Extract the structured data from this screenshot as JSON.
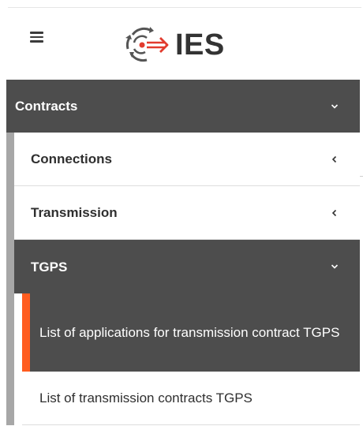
{
  "header": {
    "menu_icon": "hamburger-menu-icon",
    "logo_icon": "ies-logo-arrows-icon",
    "logo_text": "IES"
  },
  "sidebar": {
    "items": [
      {
        "label": "Contracts",
        "icon": "chevron-down-icon",
        "expanded": true,
        "children": [
          {
            "label": "Connections",
            "icon": "chevron-left-icon",
            "expanded": false
          },
          {
            "label": "Transmission",
            "icon": "chevron-left-icon",
            "expanded": false
          },
          {
            "label": "TGPS",
            "icon": "chevron-down-icon",
            "expanded": true,
            "children": [
              {
                "label": "List of applications for transmission contract TGPS",
                "current": true
              },
              {
                "label": "List of transmission contracts TGPS",
                "current": false
              }
            ]
          }
        ]
      }
    ]
  },
  "colors": {
    "menu_bg_active": "#4d4d4d",
    "nest_rail": "#a7a7a7",
    "current_indicator": "#ff5c1f",
    "logo_accent_red": "#e23b2e",
    "logo_gray": "#555555"
  }
}
